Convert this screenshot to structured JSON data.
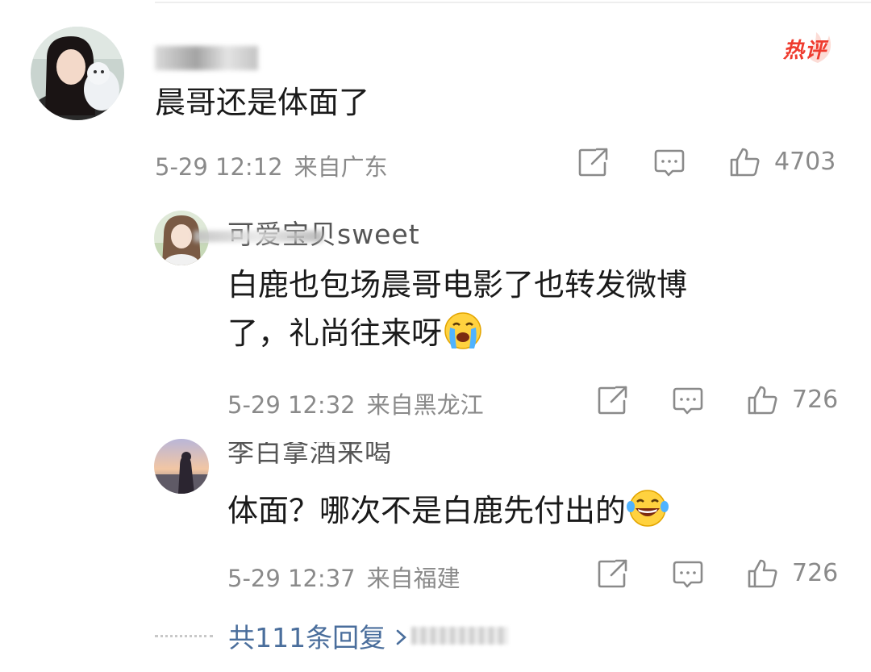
{
  "comments": [
    {
      "username": "",
      "text": "晨哥还是体面了",
      "time": "5-29 12:12",
      "location": "来自广东",
      "likes": "4703",
      "badge": "热评"
    },
    {
      "username": "可爱宝贝sweet",
      "text_line1": "白鹿也包场晨哥电影了也转发微博",
      "text_line2": "了，礼尚往来呀",
      "emoji": "crying-face",
      "time": "5-29 12:32",
      "location": "来自黑龙江",
      "likes": "726"
    },
    {
      "username": "李白拿酒来喝",
      "text": "体面？哪次不是白鹿先付出的",
      "emoji": "tears-of-joy-face",
      "time": "5-29 12:37",
      "location": "来自福建",
      "likes": "726"
    }
  ],
  "more_replies": "共111条回复",
  "icons": {
    "share": "share-icon",
    "comment": "comment-icon",
    "like": "thumbs-up-icon",
    "chevron": "chevron-right-icon"
  },
  "colors": {
    "hot_badge": "#ef3b2e",
    "link": "#4a6e9c",
    "meta": "#8a8a8a"
  }
}
